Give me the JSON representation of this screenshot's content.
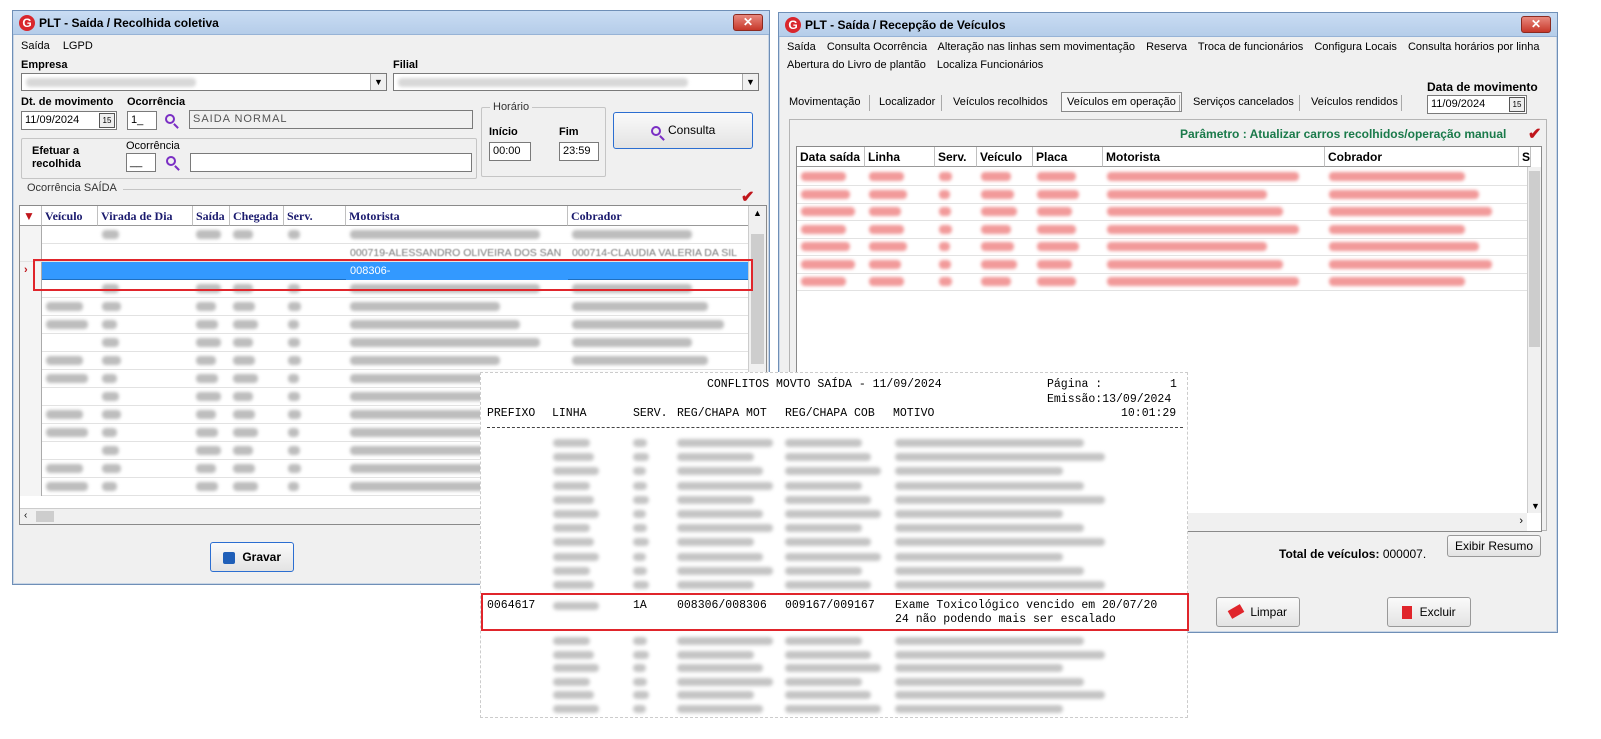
{
  "left_window": {
    "title": "PLT - Saída / Recolhida coletiva",
    "menu": [
      "Saída",
      "LGPD"
    ],
    "empresa_label": "Empresa",
    "filial_label": "Filial",
    "dt_movimento_label": "Dt. de movimento",
    "dt_movimento_value": "11/09/2024",
    "ocorrencia_label": "Ocorrência",
    "ocorrencia_code": "1_",
    "ocorrencia_desc": "SAIDA NORMAL",
    "horario_label": "Horário",
    "inicio_label": "Início",
    "inicio_value": "00:00",
    "fim_label": "Fim",
    "fim_value": "23:59",
    "consulta_button": "Consulta",
    "efetuar_label": "Efetuar a recolhida",
    "ocorrencia2_label": "Ocorrência",
    "ocorrencia2_code": "__",
    "grid_group_label": "Ocorrência SAÍDA",
    "grid_headers": [
      "Veículo",
      "Virada de Dia",
      "Saída",
      "Chegada",
      "Serv.",
      "Motorista",
      "Cobrador"
    ],
    "partial_row_motorista": "000719-ALESSANDRO OLIVEIRA DOS SAN",
    "partial_row_cobrador": "000714-CLAUDIA VALERIA DA SIL",
    "selected_motorista": "008306-",
    "gravar_button": "Gravar"
  },
  "right_window": {
    "title": "PLT - Saída / Recepção de Veículos",
    "menu_row1": [
      "Saída",
      "Consulta Ocorrência",
      "Alteração nas linhas sem movimentação",
      "Reserva",
      "Troca de funcionários",
      "Configura Locais",
      "Consulta horários por linha"
    ],
    "menu_row2": [
      "Abertura do Livro de plantão",
      "Localiza Funcionários"
    ],
    "data_movimento_label": "Data de movimento",
    "data_movimento_value": "11/09/2024",
    "tabs": [
      "Movimentação",
      "Localizador",
      "Veículos recolhidos",
      "Veículos em operação",
      "Serviços cancelados",
      "Veículos rendidos"
    ],
    "active_tab": "Veículos em operação",
    "parametro_text": "Parâmetro : Atualizar carros recolhidos/operação manual",
    "grid_headers": [
      "Data saída",
      "Linha",
      "Serv.",
      "Veículo",
      "Placa",
      "Motorista",
      "Cobrador",
      "S"
    ],
    "total_label": "Total de veículos:",
    "total_value": "000007.",
    "exibir_button": "Exibir Resumo",
    "limpar_button": "Limpar",
    "excluir_button": "Excluir"
  },
  "report": {
    "title": "CONFLITOS MOVTO SAÍDA - 11/09/2024",
    "pagina_label": "Página :",
    "pagina_value": "1",
    "emissao": "Emissão:13/09/2024",
    "time": "10:01:29",
    "headers": [
      "PREFIXO",
      "LINHA",
      "SERV.",
      "REG/CHAPA MOT",
      "REG/CHAPA COB",
      "MOTIVO"
    ],
    "highlight": {
      "prefixo": "0064617",
      "serv": "1A",
      "mot": "008306/008306",
      "cob": "009167/009167",
      "motivo_line1": "Exame Toxicológico vencido em 20/07/20",
      "motivo_line2": "24 não podendo mais ser escalado"
    }
  }
}
